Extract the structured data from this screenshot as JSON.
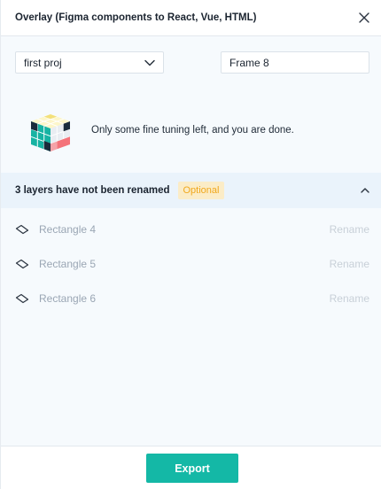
{
  "window": {
    "title": "Overlay (Figma components to React, Vue, HTML)"
  },
  "project_select": {
    "value": "first proj"
  },
  "frame_field": {
    "value": "Frame 8"
  },
  "hero": {
    "icon": "rubiks-cube-icon",
    "message": "Only some fine tuning left, and you are done."
  },
  "rename_section": {
    "label": "3 layers have not been renamed",
    "badge": "Optional",
    "expanded": true
  },
  "layers": [
    {
      "name": "Rectangle 4",
      "action": "Rename",
      "icon": "rectangle-layer-icon"
    },
    {
      "name": "Rectangle 5",
      "action": "Rename",
      "icon": "rectangle-layer-icon"
    },
    {
      "name": "Rectangle 6",
      "action": "Rename",
      "icon": "rectangle-layer-icon"
    }
  ],
  "footer": {
    "export_label": "Export"
  },
  "colors": {
    "accent": "#14b8a6",
    "badge_bg": "#fbecc7",
    "badge_text": "#f0a81d",
    "section_bg": "#eaf3fb",
    "content_bg": "#f6fafd"
  }
}
